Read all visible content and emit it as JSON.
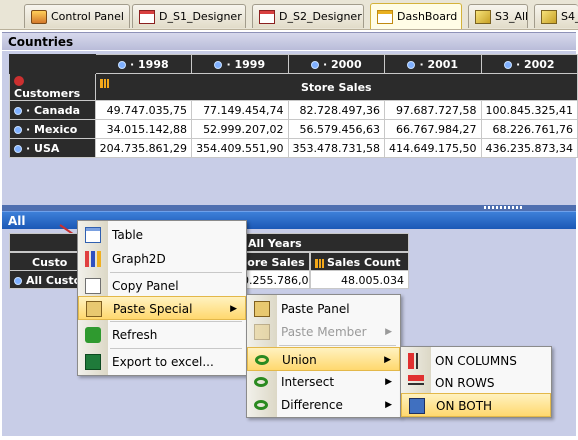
{
  "tabs": [
    {
      "label": "Control Panel",
      "icon": "control-panel-icon"
    },
    {
      "label": "D_S1_Designer",
      "icon": "designer-icon"
    },
    {
      "label": "D_S2_Designer",
      "icon": "designer-icon"
    },
    {
      "label": "DashBoard",
      "icon": "dashboard-icon"
    },
    {
      "label": "S3_All",
      "icon": "cube-icon"
    },
    {
      "label": "S4_",
      "icon": "cube-icon"
    }
  ],
  "panel1": {
    "title": "Countries",
    "corner_label": "Customers",
    "measure_label": "Store Sales",
    "years": [
      "· 1998",
      "· 1999",
      "· 2000",
      "· 2001",
      "· 2002"
    ],
    "rows": [
      {
        "label": "· Canada",
        "values": [
          "49.747.035,75",
          "77.149.454,74",
          "82.728.497,36",
          "97.687.727,58",
          "100.845.325,41"
        ]
      },
      {
        "label": "· Mexico",
        "values": [
          "34.015.142,88",
          "52.999.207,02",
          "56.579.456,63",
          "66.767.984,27",
          "68.226.761,76"
        ]
      },
      {
        "label": "· USA",
        "values": [
          "204.735.861,29",
          "354.409.551,90",
          "353.478.731,58",
          "414.649.175,50",
          "436.235.873,34"
        ]
      }
    ]
  },
  "panel2": {
    "title": "All",
    "all_years": "All Years",
    "col1": "tore Sales",
    "col2": "Sales Count",
    "row_header_corner": "Custo",
    "row_label": "All Custo",
    "val1": "0.255.786,00",
    "val2": "48.005.034"
  },
  "menu1": {
    "items": [
      {
        "label": "Table",
        "icon": "table-icon"
      },
      {
        "label": "Graph2D",
        "icon": "graph2d-icon"
      },
      {
        "label": "Copy Panel",
        "icon": "copy-icon"
      },
      {
        "label": "Paste Special",
        "icon": "paste-icon",
        "arrow": "▶"
      },
      {
        "label": "Refresh",
        "icon": "refresh-icon"
      },
      {
        "label": "Export to excel...",
        "icon": "excel-icon"
      }
    ]
  },
  "menu2": {
    "items": [
      {
        "label": "Paste Panel",
        "icon": "paste-panel-icon"
      },
      {
        "label": "Paste Member",
        "icon": "paste-member-icon",
        "arrow": "▶"
      },
      {
        "label": "Union",
        "icon": "union-icon",
        "arrow": "▶"
      },
      {
        "label": "Intersect",
        "icon": "intersect-icon",
        "arrow": "▶"
      },
      {
        "label": "Difference",
        "icon": "difference-icon",
        "arrow": "▶"
      }
    ]
  },
  "menu3": {
    "items": [
      {
        "label": "ON COLUMNS",
        "icon": "on-columns-icon"
      },
      {
        "label": "ON ROWS",
        "icon": "on-rows-icon"
      },
      {
        "label": "ON BOTH",
        "icon": "on-both-icon"
      }
    ]
  },
  "colors": {
    "panel_bg": "#c8cde7",
    "header_dark": "#2b2b2b",
    "active_header": "#1b58b6",
    "menu_highlight": "#ffd86e"
  }
}
